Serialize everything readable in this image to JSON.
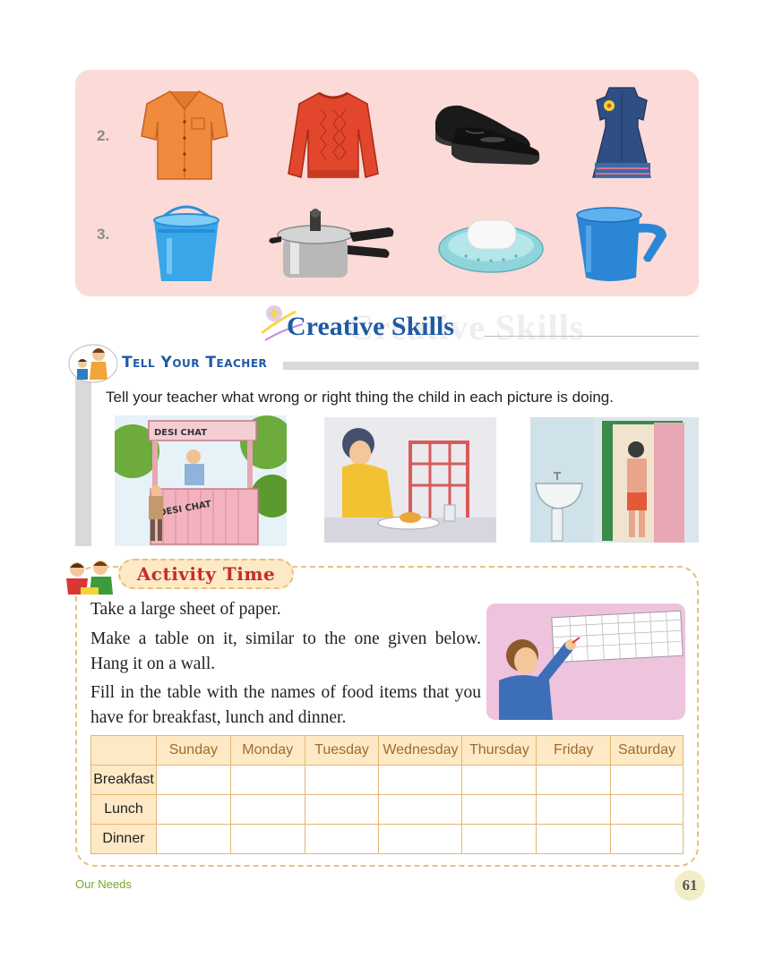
{
  "exercise_rows": [
    {
      "number": "2.",
      "items": [
        "shirt-icon",
        "sweater-icon",
        "shoes-icon",
        "dress-icon"
      ]
    },
    {
      "number": "3.",
      "items": [
        "bucket-icon",
        "pressure-cooker-icon",
        "soap-dish-icon",
        "mug-icon"
      ]
    }
  ],
  "creative_skills": {
    "title": "Creative Skills",
    "ghost_title": "Creative Skills"
  },
  "tell_your_teacher": {
    "heading": "Tell Your Teacher",
    "instruction": "Tell your teacher what wrong or right thing the child in each picture is doing.",
    "stall_sign_top": "DESI CHAT",
    "stall_sign_bottom": "DESI CHAT"
  },
  "activity_time": {
    "heading": "Activity Time",
    "paragraphs": [
      "Take a large sheet of paper.",
      "Make a table on it, similar to the one given below. Hang it on a wall.",
      "Fill in the table with the names of food items that you have for breakfast, lunch and dinner."
    ],
    "table": {
      "columns": [
        "Sunday",
        "Monday",
        "Tuesday",
        "Wednesday",
        "Thursday",
        "Friday",
        "Saturday"
      ],
      "rows": [
        "Breakfast",
        "Lunch",
        "Dinner"
      ]
    }
  },
  "footer": {
    "chapter": "Our Needs",
    "page_number": "61"
  },
  "colors": {
    "panel_pink": "#fbdad7",
    "title_blue": "#1f5aa6",
    "activity_red": "#c72b2b",
    "table_border": "#e3b772",
    "footer_green": "#7aa72c"
  }
}
